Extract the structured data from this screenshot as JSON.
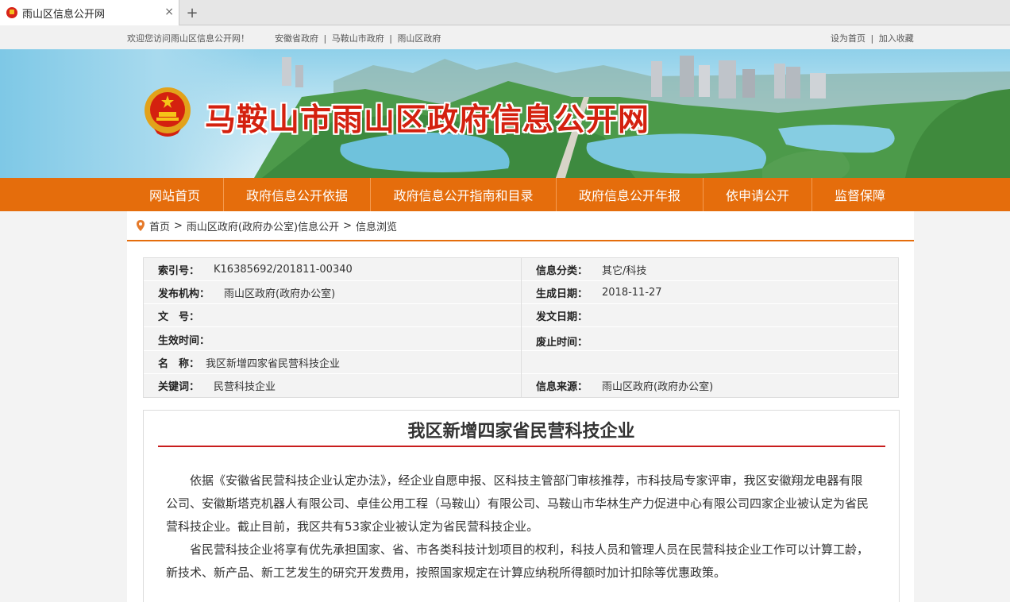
{
  "browser": {
    "tab_title": "雨山区信息公开网",
    "close_glyph": "×",
    "newtab_glyph": "+"
  },
  "topbar": {
    "welcome": "欢迎您访问雨山区信息公开网！",
    "gov_links": [
      "安徽省政府",
      "马鞍山市政府",
      "雨山区政府"
    ],
    "right_links": [
      "设为首页",
      "加入收藏"
    ],
    "separator": "|"
  },
  "banner": {
    "title": "马鞍山市雨山区政府信息公开网"
  },
  "nav": {
    "items": [
      {
        "label": "网站首页"
      },
      {
        "label": "政府信息公开依据"
      },
      {
        "label": "政府信息公开指南和目录"
      },
      {
        "label": "政府信息公开年报"
      },
      {
        "label": "依申请公开"
      },
      {
        "label": "监督保障"
      }
    ]
  },
  "breadcrumb": {
    "items": [
      "首页",
      "雨山区政府(政府办公室)信息公开",
      "信息浏览"
    ],
    "separator": ">"
  },
  "info": {
    "index_no_label": "索引号：",
    "index_no": "K16385692/201811-00340",
    "category_label": "信息分类：",
    "category": "其它/科技",
    "publisher_label": "发布机构：",
    "publisher": "雨山区政府(政府办公室)",
    "gen_date_label": "生成日期：",
    "gen_date": "2018-11-27",
    "doc_no_label": "文　号：",
    "doc_no": "",
    "pub_date_label": "发文日期：",
    "pub_date": "",
    "effective_label": "生效时间：",
    "effective": "",
    "expire_label": "废止时间：",
    "expire": "",
    "name_label": "名　称：",
    "name": "我区新增四家省民营科技企业",
    "keywords_label": "关键词：",
    "keywords": "民营科技企业",
    "source_label": "信息来源：",
    "source": "雨山区政府(政府办公室)"
  },
  "article": {
    "title": "我区新增四家省民营科技企业",
    "paragraphs": [
      "依据《安徽省民营科技企业认定办法》，经企业自愿申报、区科技主管部门审核推荐，市科技局专家评审，我区安徽翔龙电器有限公司、安徽斯塔克机器人有限公司、卓佳公用工程（马鞍山）有限公司、马鞍山市华林生产力促进中心有限公司四家企业被认定为省民营科技企业。截止目前，我区共有53家企业被认定为省民营科技企业。",
      "省民营科技企业将享有优先承担国家、省、市各类科技计划项目的权利，科技人员和管理人员在民营科技企业工作可以计算工龄，新技术、新产品、新工艺发生的研究开发费用，按照国家规定在计算应纳税所得额时加计扣除等优惠政策。"
    ]
  },
  "colors": {
    "nav_orange": "#e56d0c",
    "title_red": "#d4210f",
    "rule_red": "#c81d1d"
  }
}
